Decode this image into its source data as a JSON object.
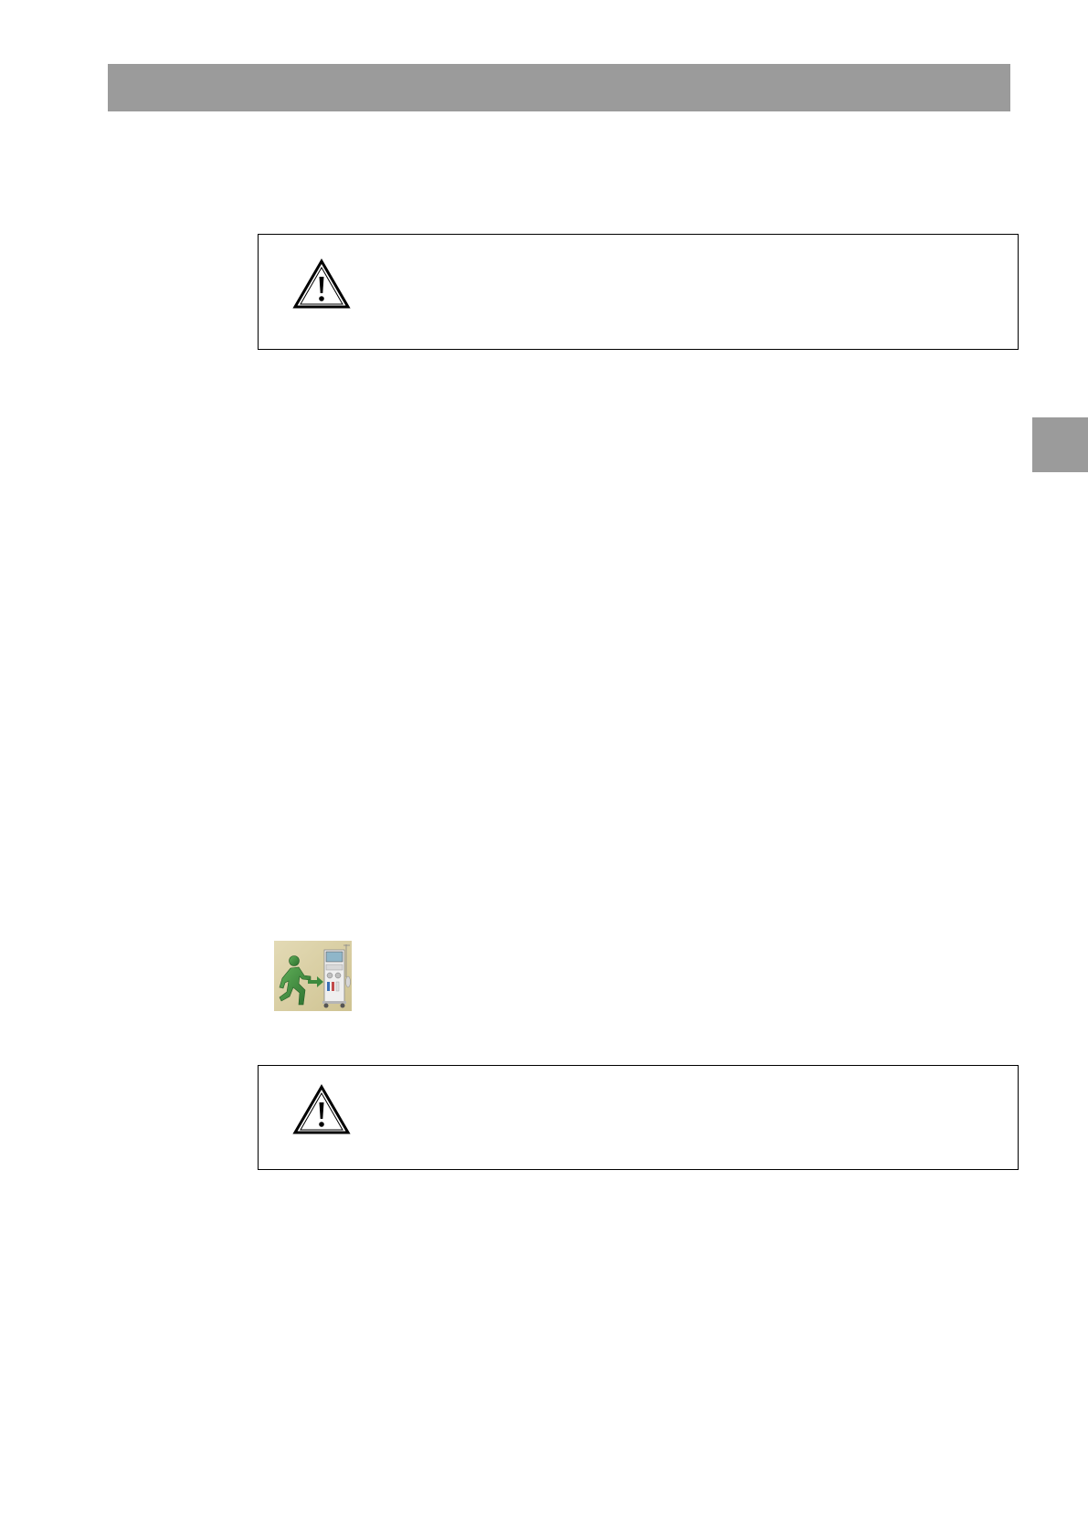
{
  "header_bar": {
    "color": "#9b9b9b"
  },
  "thumb_tab": {
    "color": "#9b9b9b"
  },
  "warnings": [
    {
      "icon": "warning-triangle-icon"
    },
    {
      "icon": "warning-triangle-icon"
    }
  ],
  "action_icon": {
    "icon": "patient-to-machine-icon",
    "colors": {
      "background": "#d9cfa6",
      "figure": "#3d8a3e",
      "machine": "#e6e6e6"
    }
  }
}
